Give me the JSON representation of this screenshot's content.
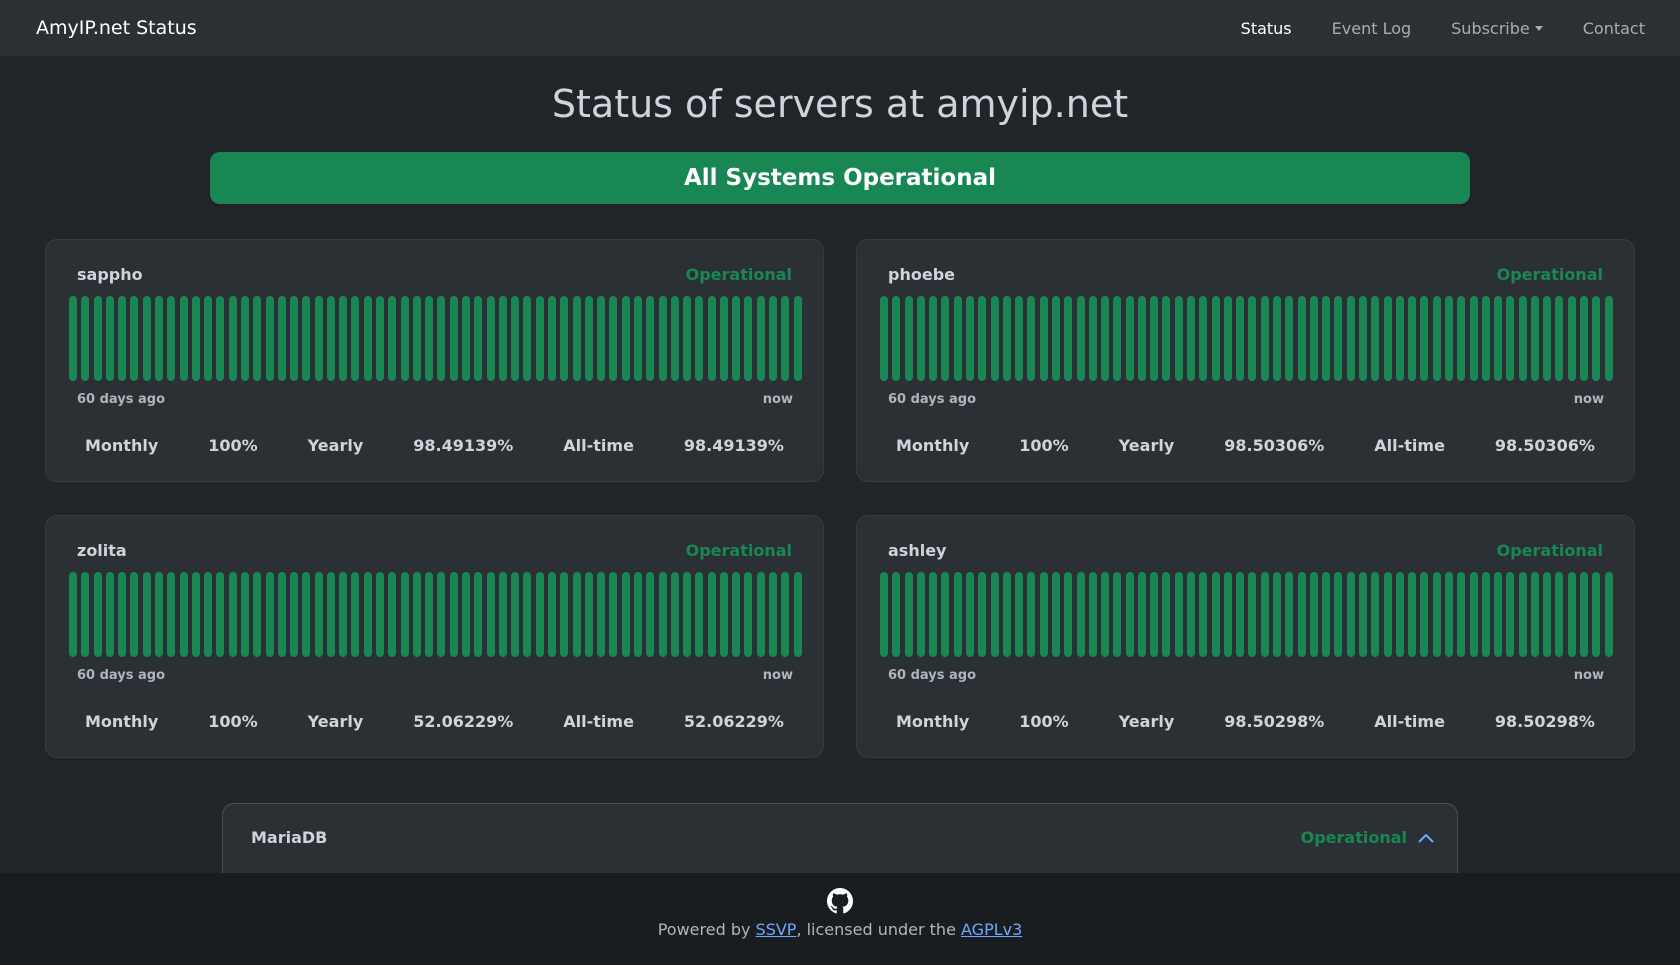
{
  "navbar": {
    "brand": "AmyIP.net Status",
    "links": [
      {
        "label": "Status"
      },
      {
        "label": "Event Log"
      },
      {
        "label": "Subscribe"
      },
      {
        "label": "Contact"
      }
    ]
  },
  "page_title": "Status of servers at amyip.net",
  "banner": "All Systems Operational",
  "colors": {
    "operational": "#198754",
    "background": "#212529",
    "card": "#2b3035"
  },
  "servers": [
    {
      "name": "sappho",
      "status": "Operational",
      "start_label": "60 days ago",
      "end_label": "now",
      "bars": 60,
      "monthly_label": "Monthly",
      "monthly": "100%",
      "yearly_label": "Yearly",
      "yearly": "98.49139%",
      "alltime_label": "All-time",
      "alltime": "98.49139%"
    },
    {
      "name": "phoebe",
      "status": "Operational",
      "start_label": "60 days ago",
      "end_label": "now",
      "bars": 60,
      "monthly_label": "Monthly",
      "monthly": "100%",
      "yearly_label": "Yearly",
      "yearly": "98.50306%",
      "alltime_label": "All-time",
      "alltime": "98.50306%"
    },
    {
      "name": "zolita",
      "status": "Operational",
      "start_label": "60 days ago",
      "end_label": "now",
      "bars": 60,
      "monthly_label": "Monthly",
      "monthly": "100%",
      "yearly_label": "Yearly",
      "yearly": "52.06229%",
      "alltime_label": "All-time",
      "alltime": "52.06229%"
    },
    {
      "name": "ashley",
      "status": "Operational",
      "start_label": "60 days ago",
      "end_label": "now",
      "bars": 60,
      "monthly_label": "Monthly",
      "monthly": "100%",
      "yearly_label": "Yearly",
      "yearly": "98.50298%",
      "alltime_label": "All-time",
      "alltime": "98.50298%"
    }
  ],
  "service_group": {
    "name": "MariaDB",
    "status": "Operational",
    "icon": "chevron-up-icon"
  },
  "footer": {
    "icon": "github-icon",
    "prefix": "Powered by ",
    "link1": "SSVP",
    "middle": ", licensed under the ",
    "link2": "AGPLv3"
  }
}
